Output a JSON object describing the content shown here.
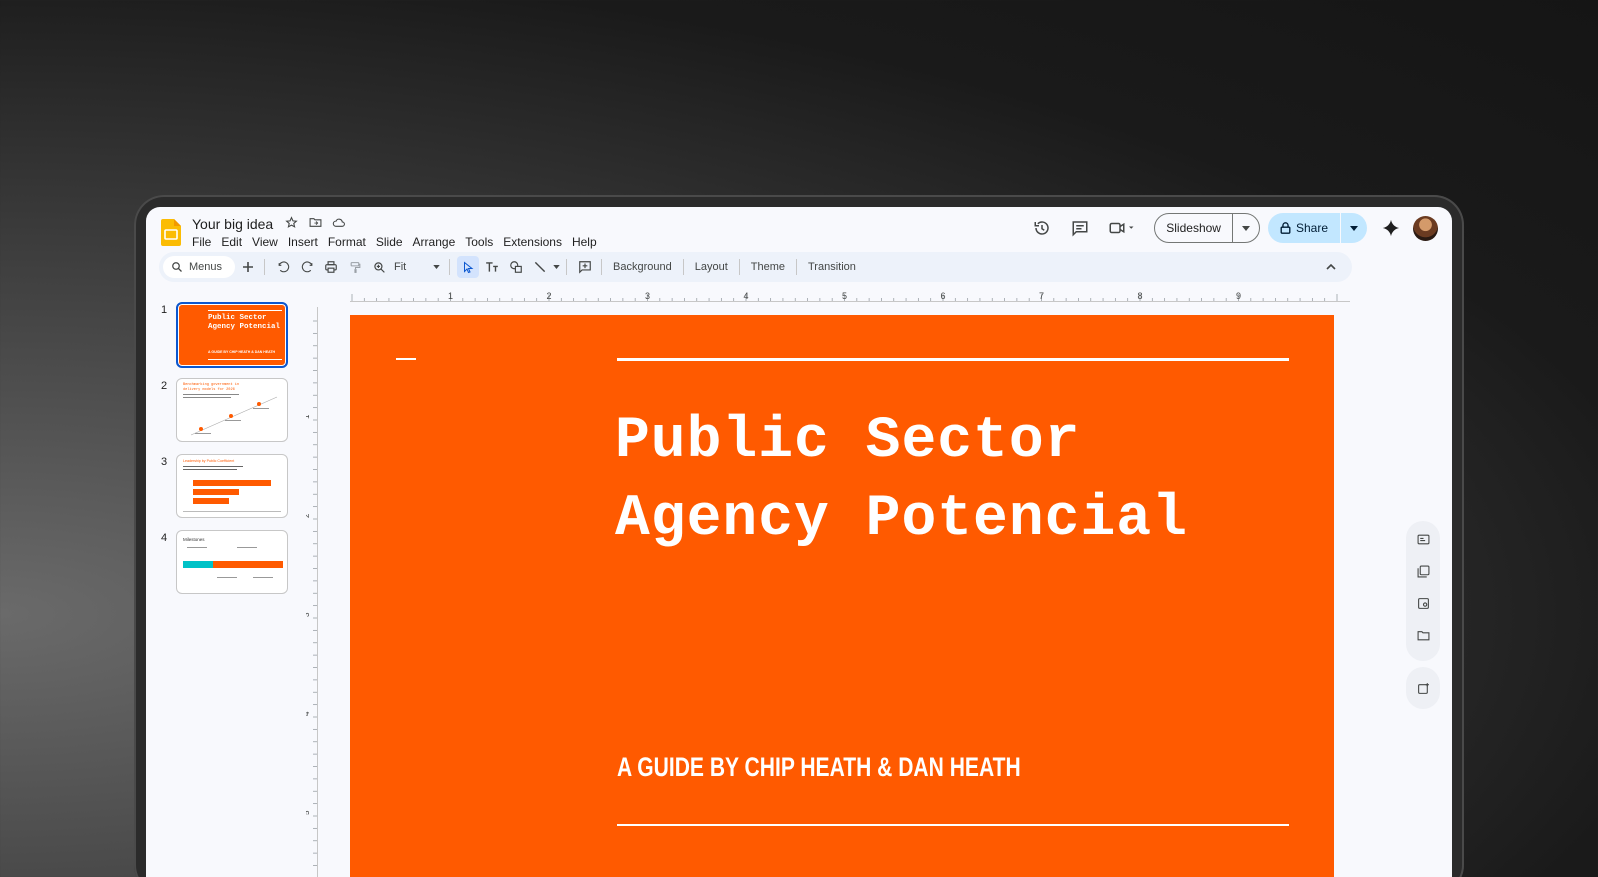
{
  "app": {
    "doc_title": "Your big idea",
    "menu": [
      "File",
      "Edit",
      "View",
      "Insert",
      "Format",
      "Slide",
      "Arrange",
      "Tools",
      "Extensions",
      "Help"
    ]
  },
  "header": {
    "slideshow_label": "Slideshow",
    "share_label": "Share"
  },
  "toolbar": {
    "search_placeholder": "Menus",
    "zoom_value": "Fit",
    "background_label": "Background",
    "layout_label": "Layout",
    "theme_label": "Theme",
    "transition_label": "Transition"
  },
  "ruler": {
    "h_ticks": [
      "1",
      "2",
      "3",
      "4",
      "5",
      "6",
      "7",
      "8",
      "9"
    ],
    "v_ticks": [
      "1",
      "2",
      "3",
      "4",
      "5"
    ]
  },
  "thumbnails": [
    {
      "num": "1",
      "title": "Public Sector Agency Potencial",
      "subtitle": "A GUIDE BY CHIP HEATH & DAN HEATH"
    },
    {
      "num": "2",
      "title": "Benchmarking government in delivery models for 2026"
    },
    {
      "num": "3",
      "title": "Leadership by Public Coefficient"
    },
    {
      "num": "4",
      "title": "Milestones"
    }
  ],
  "slide": {
    "title_line1": "Public Sector",
    "title_line2": "Agency Potencial",
    "subtitle": "A GUIDE BY CHIP HEATH & DAN HEATH"
  },
  "colors": {
    "accent": "#ff5a00",
    "share_bg": "#c2e7ff",
    "select_bg": "#d3e3fd",
    "selection_border": "#0b57d0"
  }
}
